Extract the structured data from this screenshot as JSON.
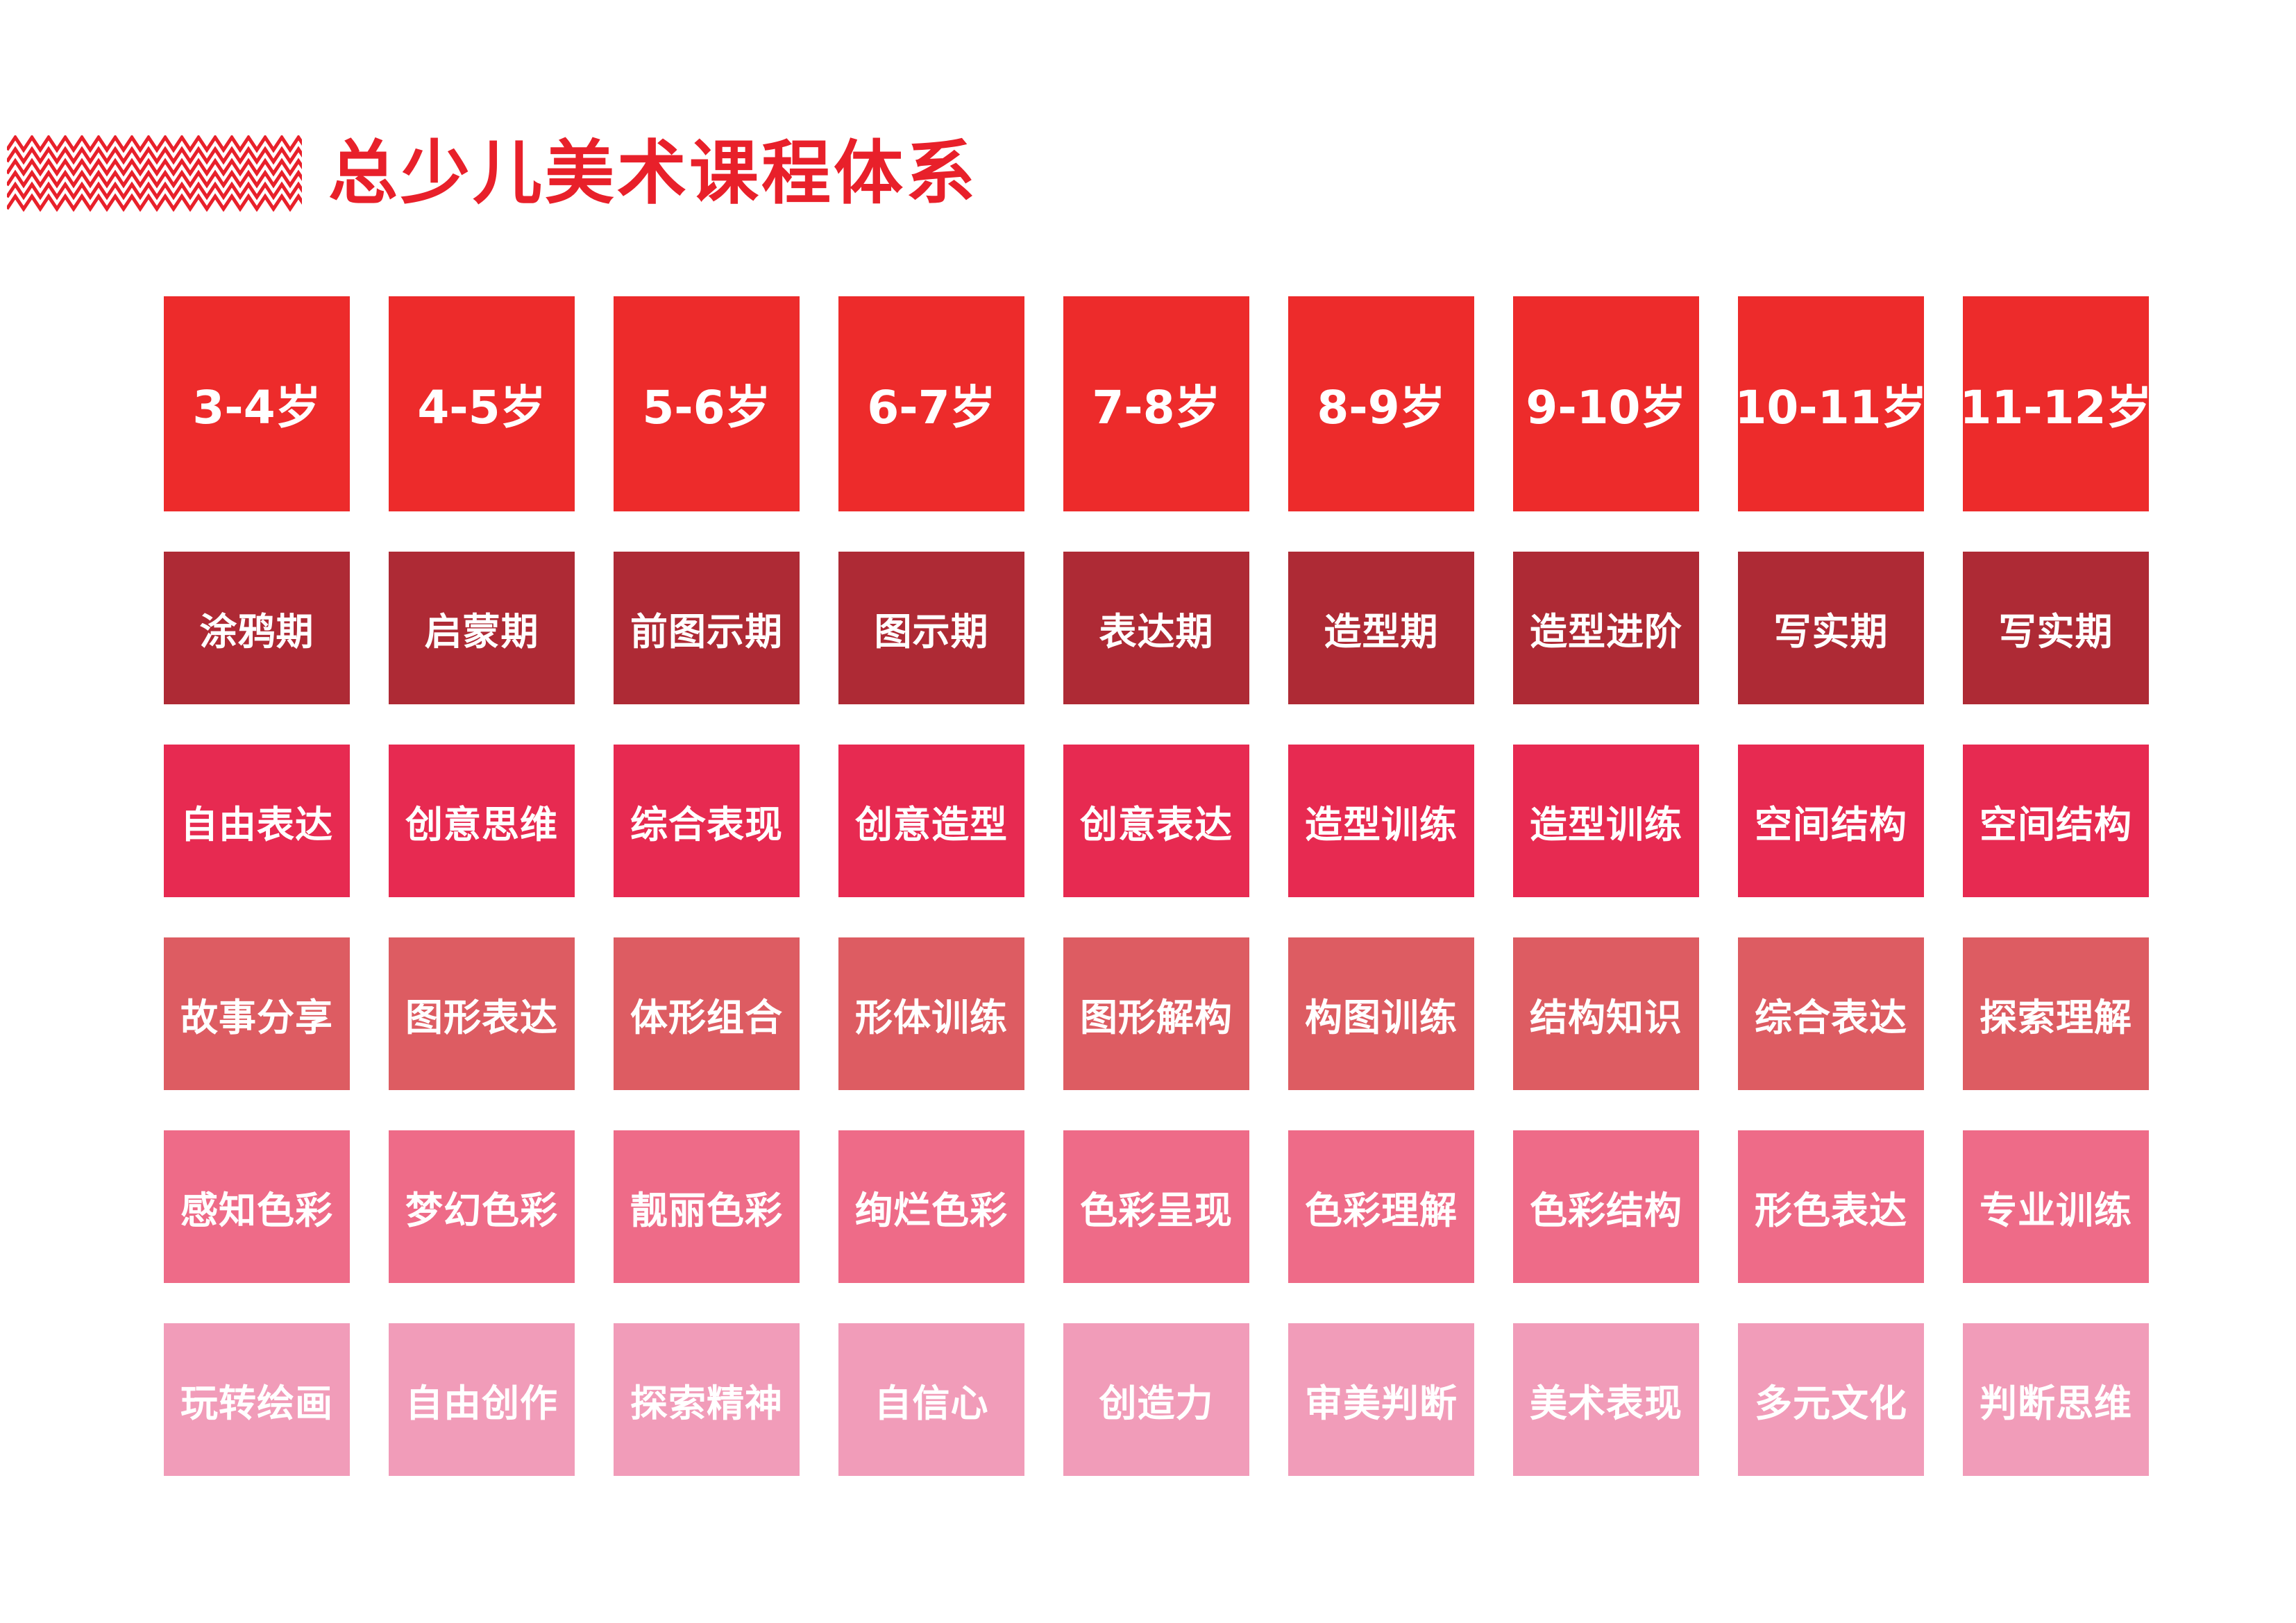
{
  "header": {
    "title": "总少儿美术课程体系",
    "title_color": "#e8202a",
    "pattern_icon": "zigzag-pattern-icon"
  },
  "rows": [
    {
      "name": "age",
      "color": "#ed2b2b",
      "cells": [
        "3-4岁",
        "4-5岁",
        "5-6岁",
        "6-7岁",
        "7-8岁",
        "8-9岁",
        "9-10岁",
        "10-11岁",
        "11-12岁"
      ]
    },
    {
      "name": "stage",
      "color": "#ae2a35",
      "cells": [
        "涂鸦期",
        "启蒙期",
        "前图示期",
        "图示期",
        "表达期",
        "造型期",
        "造型进阶",
        "写实期",
        "写实期"
      ]
    },
    {
      "name": "expression",
      "color": "#e72a51",
      "cells": [
        "自由表达",
        "创意思维",
        "综合表现",
        "创意造型",
        "创意表达",
        "造型训练",
        "造型训练",
        "空间结构",
        "空间结构"
      ]
    },
    {
      "name": "structure",
      "color": "#dd5c62",
      "cells": [
        "故事分享",
        "图形表达",
        "体形组合",
        "形体训练",
        "图形解构",
        "构图训练",
        "结构知识",
        "综合表达",
        "探索理解"
      ]
    },
    {
      "name": "color",
      "color": "#ee6b88",
      "cells": [
        "感知色彩",
        "梦幻色彩",
        "靓丽色彩",
        "绚烂色彩",
        "色彩呈现",
        "色彩理解",
        "色彩结构",
        "形色表达",
        "专业训练"
      ]
    },
    {
      "name": "ability",
      "color": "#f19cb9",
      "cells": [
        "玩转绘画",
        "自由创作",
        "探索精神",
        "自信心",
        "创造力",
        "审美判断",
        "美术表现",
        "多元文化",
        "判断思维"
      ]
    }
  ]
}
